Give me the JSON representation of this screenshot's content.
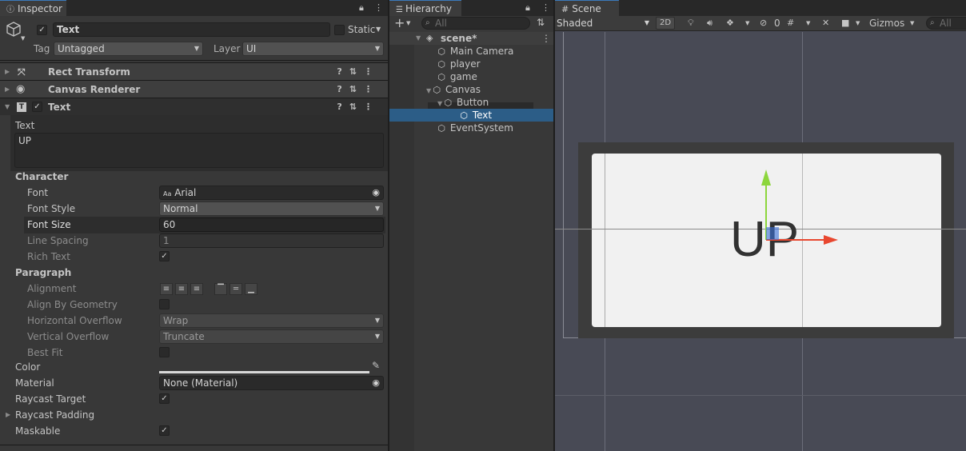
{
  "inspector": {
    "tab_title": "Inspector",
    "object_name": "Text",
    "static_label": "Static",
    "tag_label": "Tag",
    "tag_value": "Untagged",
    "layer_label": "Layer",
    "layer_value": "UI",
    "components": {
      "rect_transform": "Rect Transform",
      "canvas_renderer": "Canvas Renderer",
      "text": "Text"
    },
    "text_label": "Text",
    "text_value": "UP",
    "character_header": "Character",
    "font_label": "Font",
    "font_value": "Arial",
    "font_style_label": "Font Style",
    "font_style_value": "Normal",
    "font_size_label": "Font Size",
    "font_size_value": "60",
    "line_spacing_label": "Line Spacing",
    "line_spacing_value": "1",
    "rich_text_label": "Rich Text",
    "paragraph_header": "Paragraph",
    "alignment_label": "Alignment",
    "align_by_geometry_label": "Align By Geometry",
    "horizontal_overflow_label": "Horizontal Overflow",
    "horizontal_overflow_value": "Wrap",
    "vertical_overflow_label": "Vertical Overflow",
    "vertical_overflow_value": "Truncate",
    "best_fit_label": "Best Fit",
    "color_label": "Color",
    "material_label": "Material",
    "material_value": "None (Material)",
    "raycast_target_label": "Raycast Target",
    "raycast_padding_label": "Raycast Padding",
    "maskable_label": "Maskable",
    "checkmark": "✓"
  },
  "hierarchy": {
    "tab_title": "Hierarchy",
    "search_placeholder": "All",
    "scene_name": "scene*",
    "items": [
      "Main Camera",
      "player",
      "game",
      "Canvas",
      "Button",
      "Text",
      "EventSystem"
    ]
  },
  "scene": {
    "tab_title": "Scene",
    "shading_mode": "Shaded",
    "toggle_2d": "2D",
    "hidden_count": "0",
    "gizmos_label": "Gizmos",
    "search_placeholder": "All",
    "button_text": "UP"
  },
  "colors": {
    "selection": "#2c5d87",
    "gizmo_x": "#e8472f",
    "gizmo_y": "#8cd63c",
    "scene_bg": "#484a55"
  }
}
